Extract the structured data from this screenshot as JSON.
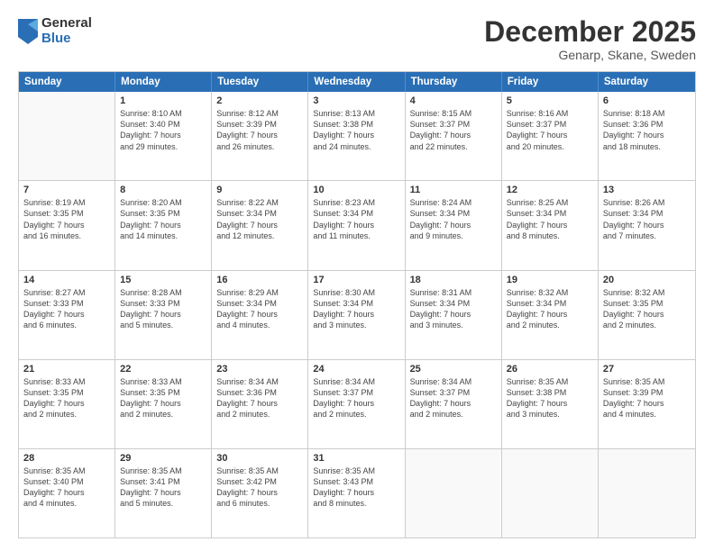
{
  "logo": {
    "general": "General",
    "blue": "Blue"
  },
  "title": "December 2025",
  "subtitle": "Genarp, Skane, Sweden",
  "header_days": [
    "Sunday",
    "Monday",
    "Tuesday",
    "Wednesday",
    "Thursday",
    "Friday",
    "Saturday"
  ],
  "weeks": [
    [
      {
        "day": "",
        "lines": []
      },
      {
        "day": "1",
        "lines": [
          "Sunrise: 8:10 AM",
          "Sunset: 3:40 PM",
          "Daylight: 7 hours",
          "and 29 minutes."
        ]
      },
      {
        "day": "2",
        "lines": [
          "Sunrise: 8:12 AM",
          "Sunset: 3:39 PM",
          "Daylight: 7 hours",
          "and 26 minutes."
        ]
      },
      {
        "day": "3",
        "lines": [
          "Sunrise: 8:13 AM",
          "Sunset: 3:38 PM",
          "Daylight: 7 hours",
          "and 24 minutes."
        ]
      },
      {
        "day": "4",
        "lines": [
          "Sunrise: 8:15 AM",
          "Sunset: 3:37 PM",
          "Daylight: 7 hours",
          "and 22 minutes."
        ]
      },
      {
        "day": "5",
        "lines": [
          "Sunrise: 8:16 AM",
          "Sunset: 3:37 PM",
          "Daylight: 7 hours",
          "and 20 minutes."
        ]
      },
      {
        "day": "6",
        "lines": [
          "Sunrise: 8:18 AM",
          "Sunset: 3:36 PM",
          "Daylight: 7 hours",
          "and 18 minutes."
        ]
      }
    ],
    [
      {
        "day": "7",
        "lines": [
          "Sunrise: 8:19 AM",
          "Sunset: 3:35 PM",
          "Daylight: 7 hours",
          "and 16 minutes."
        ]
      },
      {
        "day": "8",
        "lines": [
          "Sunrise: 8:20 AM",
          "Sunset: 3:35 PM",
          "Daylight: 7 hours",
          "and 14 minutes."
        ]
      },
      {
        "day": "9",
        "lines": [
          "Sunrise: 8:22 AM",
          "Sunset: 3:34 PM",
          "Daylight: 7 hours",
          "and 12 minutes."
        ]
      },
      {
        "day": "10",
        "lines": [
          "Sunrise: 8:23 AM",
          "Sunset: 3:34 PM",
          "Daylight: 7 hours",
          "and 11 minutes."
        ]
      },
      {
        "day": "11",
        "lines": [
          "Sunrise: 8:24 AM",
          "Sunset: 3:34 PM",
          "Daylight: 7 hours",
          "and 9 minutes."
        ]
      },
      {
        "day": "12",
        "lines": [
          "Sunrise: 8:25 AM",
          "Sunset: 3:34 PM",
          "Daylight: 7 hours",
          "and 8 minutes."
        ]
      },
      {
        "day": "13",
        "lines": [
          "Sunrise: 8:26 AM",
          "Sunset: 3:34 PM",
          "Daylight: 7 hours",
          "and 7 minutes."
        ]
      }
    ],
    [
      {
        "day": "14",
        "lines": [
          "Sunrise: 8:27 AM",
          "Sunset: 3:33 PM",
          "Daylight: 7 hours",
          "and 6 minutes."
        ]
      },
      {
        "day": "15",
        "lines": [
          "Sunrise: 8:28 AM",
          "Sunset: 3:33 PM",
          "Daylight: 7 hours",
          "and 5 minutes."
        ]
      },
      {
        "day": "16",
        "lines": [
          "Sunrise: 8:29 AM",
          "Sunset: 3:34 PM",
          "Daylight: 7 hours",
          "and 4 minutes."
        ]
      },
      {
        "day": "17",
        "lines": [
          "Sunrise: 8:30 AM",
          "Sunset: 3:34 PM",
          "Daylight: 7 hours",
          "and 3 minutes."
        ]
      },
      {
        "day": "18",
        "lines": [
          "Sunrise: 8:31 AM",
          "Sunset: 3:34 PM",
          "Daylight: 7 hours",
          "and 3 minutes."
        ]
      },
      {
        "day": "19",
        "lines": [
          "Sunrise: 8:32 AM",
          "Sunset: 3:34 PM",
          "Daylight: 7 hours",
          "and 2 minutes."
        ]
      },
      {
        "day": "20",
        "lines": [
          "Sunrise: 8:32 AM",
          "Sunset: 3:35 PM",
          "Daylight: 7 hours",
          "and 2 minutes."
        ]
      }
    ],
    [
      {
        "day": "21",
        "lines": [
          "Sunrise: 8:33 AM",
          "Sunset: 3:35 PM",
          "Daylight: 7 hours",
          "and 2 minutes."
        ]
      },
      {
        "day": "22",
        "lines": [
          "Sunrise: 8:33 AM",
          "Sunset: 3:35 PM",
          "Daylight: 7 hours",
          "and 2 minutes."
        ]
      },
      {
        "day": "23",
        "lines": [
          "Sunrise: 8:34 AM",
          "Sunset: 3:36 PM",
          "Daylight: 7 hours",
          "and 2 minutes."
        ]
      },
      {
        "day": "24",
        "lines": [
          "Sunrise: 8:34 AM",
          "Sunset: 3:37 PM",
          "Daylight: 7 hours",
          "and 2 minutes."
        ]
      },
      {
        "day": "25",
        "lines": [
          "Sunrise: 8:34 AM",
          "Sunset: 3:37 PM",
          "Daylight: 7 hours",
          "and 2 minutes."
        ]
      },
      {
        "day": "26",
        "lines": [
          "Sunrise: 8:35 AM",
          "Sunset: 3:38 PM",
          "Daylight: 7 hours",
          "and 3 minutes."
        ]
      },
      {
        "day": "27",
        "lines": [
          "Sunrise: 8:35 AM",
          "Sunset: 3:39 PM",
          "Daylight: 7 hours",
          "and 4 minutes."
        ]
      }
    ],
    [
      {
        "day": "28",
        "lines": [
          "Sunrise: 8:35 AM",
          "Sunset: 3:40 PM",
          "Daylight: 7 hours",
          "and 4 minutes."
        ]
      },
      {
        "day": "29",
        "lines": [
          "Sunrise: 8:35 AM",
          "Sunset: 3:41 PM",
          "Daylight: 7 hours",
          "and 5 minutes."
        ]
      },
      {
        "day": "30",
        "lines": [
          "Sunrise: 8:35 AM",
          "Sunset: 3:42 PM",
          "Daylight: 7 hours",
          "and 6 minutes."
        ]
      },
      {
        "day": "31",
        "lines": [
          "Sunrise: 8:35 AM",
          "Sunset: 3:43 PM",
          "Daylight: 7 hours",
          "and 8 minutes."
        ]
      },
      {
        "day": "",
        "lines": []
      },
      {
        "day": "",
        "lines": []
      },
      {
        "day": "",
        "lines": []
      }
    ]
  ]
}
